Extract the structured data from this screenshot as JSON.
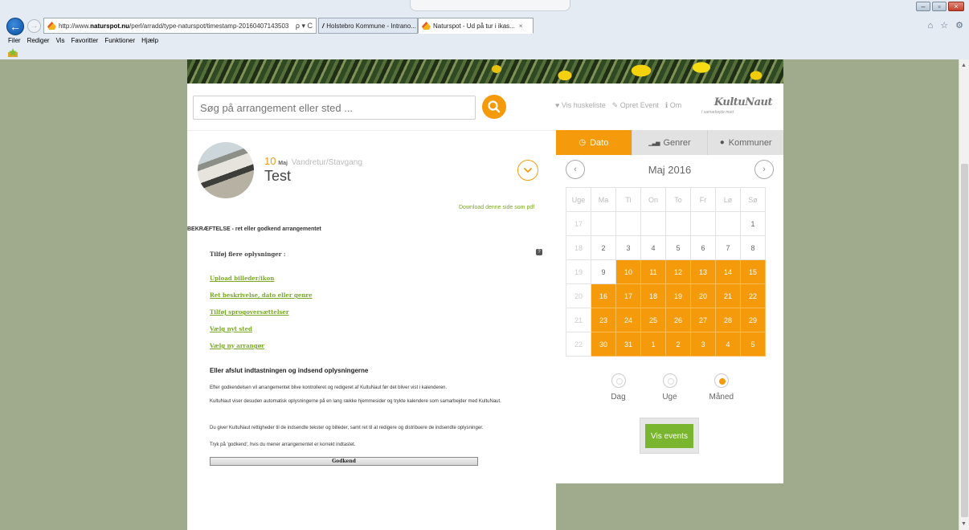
{
  "browser": {
    "url_prefix": "http://www.",
    "url_domain": "naturspot.nu",
    "url_path": "/perl/arradd/type-naturspot/timestamp-20160407143503",
    "addr_tools": "ρ ▾ C",
    "tabs": [
      {
        "label": "Holstebro Kommune - Intrano..."
      },
      {
        "label": "Naturspot - Ud på tur i ikas..."
      }
    ],
    "tab_close": "×",
    "menu": [
      "Filer",
      "Rediger",
      "Vis",
      "Favoritter",
      "Funktioner",
      "Hjælp"
    ],
    "toolbar_icons": "⌂ ☆ ⚙",
    "window_buttons": [
      "–",
      "▫",
      "×"
    ]
  },
  "site": {
    "search_placeholder": "Søg på arrangement eller sted ...",
    "links": [
      {
        "icon": "heart-icon",
        "label": "Vis huskeliste"
      },
      {
        "icon": "pencil-icon",
        "label": "Opret Event"
      },
      {
        "icon": "info-icon",
        "label": "Om"
      }
    ],
    "logo_text": "KultuNaut",
    "logo_tagline": "I samarbejde med"
  },
  "event": {
    "day": "10",
    "month": "Maj",
    "genre": "Vandretur/Stavgang",
    "title": "Test",
    "pdf_link": "Download denne side som pdf"
  },
  "confirm": {
    "heading": "BEKRÆFTELSE - ret eller godkend arrangementet",
    "add_info": "Tilføj flere oplysninger :",
    "help": "?",
    "actions": [
      "Upload billeder/ikon",
      "Ret beskrivelse, dato eller genre",
      "Tilføj sprogoversættelser",
      "Vælg nyt sted",
      "Vælg ny arrangør"
    ],
    "finish_heading": "Eller afslut indtastningen og indsend oplysningerne",
    "paragraphs": [
      "Efter godkendelsen vil arrangementet blive kontrolleret og redigeret af KultuNaut før det bliver vist i kalenderen.",
      "KultuNaut viser desuden automatisk oplysningerne på en lang række hjemmesider og trykte kalendere som samarbejder med KultuNaut.",
      "Du giver KultuNaut rettigheder til de indsendte tekster og billeder, samt ret til at redigere og distribuere de indsendte oplysninger.",
      "Tryk på 'godkend', hvis du mener arrangementet er korrekt indtastet."
    ],
    "approve_label": "Godkend"
  },
  "calendar": {
    "tabs": [
      {
        "icon": "clock-icon",
        "glyph": "◷",
        "label": "Dato"
      },
      {
        "icon": "bar-chart-icon",
        "glyph": "▁▃▅",
        "label": "Genrer"
      },
      {
        "icon": "globe-icon",
        "glyph": "●",
        "label": "Kommuner"
      }
    ],
    "prev": "‹",
    "next": "›",
    "month_label": "Maj 2016",
    "headers": [
      "Uge",
      "Ma",
      "Ti",
      "On",
      "To",
      "Fr",
      "Lø",
      "Sø"
    ],
    "weeks": [
      {
        "week": "17",
        "days": [
          "",
          "",
          "",
          "",
          "",
          "",
          "1"
        ]
      },
      {
        "week": "18",
        "days": [
          "2",
          "3",
          "4",
          "5",
          "6",
          "7",
          "8"
        ]
      },
      {
        "week": "19",
        "days": [
          "9",
          "10",
          "11",
          "12",
          "13",
          "14",
          "15"
        ]
      },
      {
        "week": "20",
        "days": [
          "16",
          "17",
          "18",
          "19",
          "20",
          "21",
          "22"
        ]
      },
      {
        "week": "21",
        "days": [
          "23",
          "24",
          "25",
          "26",
          "27",
          "28",
          "29"
        ]
      },
      {
        "week": "22",
        "days": [
          "30",
          "31",
          "1",
          "2",
          "3",
          "4",
          "5"
        ]
      }
    ],
    "highlight_from": {
      "row": 2,
      "col": 1
    },
    "view_options": [
      "Dag",
      "Uge",
      "Måned"
    ],
    "selected_view": "Måned",
    "show_button": "Vis events",
    "accent_color": "#f59a0a",
    "button_color": "#7ab530"
  }
}
